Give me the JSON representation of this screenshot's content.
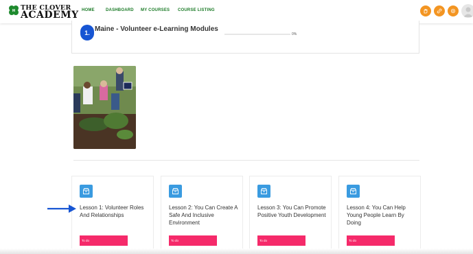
{
  "header": {
    "logo_line1": "THE CLOVER",
    "logo_line2": "ACADEMY",
    "nav": [
      "HOME",
      "DASHBOARD",
      "MY COURSES",
      "COURSE LISTING"
    ],
    "icons": [
      "hand-icon",
      "link-icon",
      "settings-icon"
    ],
    "accent_color": "#f39522",
    "nav_color": "#1a7a26"
  },
  "course": {
    "number": "1.",
    "title": "Maine - Volunteer e-Learning Modules",
    "progress_pct": 0,
    "progress_label": "0%"
  },
  "lessons": [
    {
      "title": "Lesson 1: Volunteer Roles And Relationships",
      "badge": "To do"
    },
    {
      "title": "Lesson 2: You Can Create A Safe And Inclusive Environment",
      "badge": "To do"
    },
    {
      "title": "Lesson 3: You Can Promote Positive Youth Development",
      "badge": "To do"
    },
    {
      "title": "Lesson 4: You Can Help Young People Learn By Doing",
      "badge": "To do"
    }
  ],
  "colors": {
    "course_number": "#1755d3",
    "lesson_icon": "#3a9be0",
    "badge": "#f52a6a",
    "arrow": "#1755d3"
  }
}
